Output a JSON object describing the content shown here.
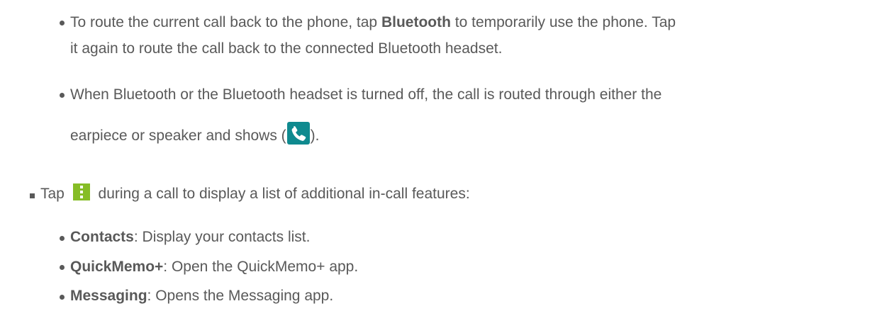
{
  "items": {
    "bluetooth_bullet": {
      "text_a": "To route the current call back to the phone, tap ",
      "bold": "Bluetooth",
      "text_b": " to temporarily use the phone. Tap",
      "line2": "it again to route the call back to the connected Bluetooth headset."
    },
    "off_bullet": {
      "line1": "When Bluetooth or the Bluetooth headset is turned off, the call is routed through either the",
      "line2_a": "earpiece or speaker and shows (",
      "line2_b": ")."
    },
    "menu_item": {
      "text_a": "Tap ",
      "text_b": " during a call to display a list of additional in-call features:"
    },
    "features": [
      {
        "name": "Contacts",
        "desc": ": Display your contacts list."
      },
      {
        "name": "QuickMemo+",
        "desc": ": Open the QuickMemo+ app."
      },
      {
        "name": "Messaging",
        "desc": ": Opens the Messaging app."
      }
    ]
  },
  "icons": {
    "phone": "phone-icon",
    "menu": "more-options-icon"
  },
  "colors": {
    "text": "#595959",
    "phone_icon": "#0f8a8f",
    "menu_icon": "#86bd26"
  }
}
